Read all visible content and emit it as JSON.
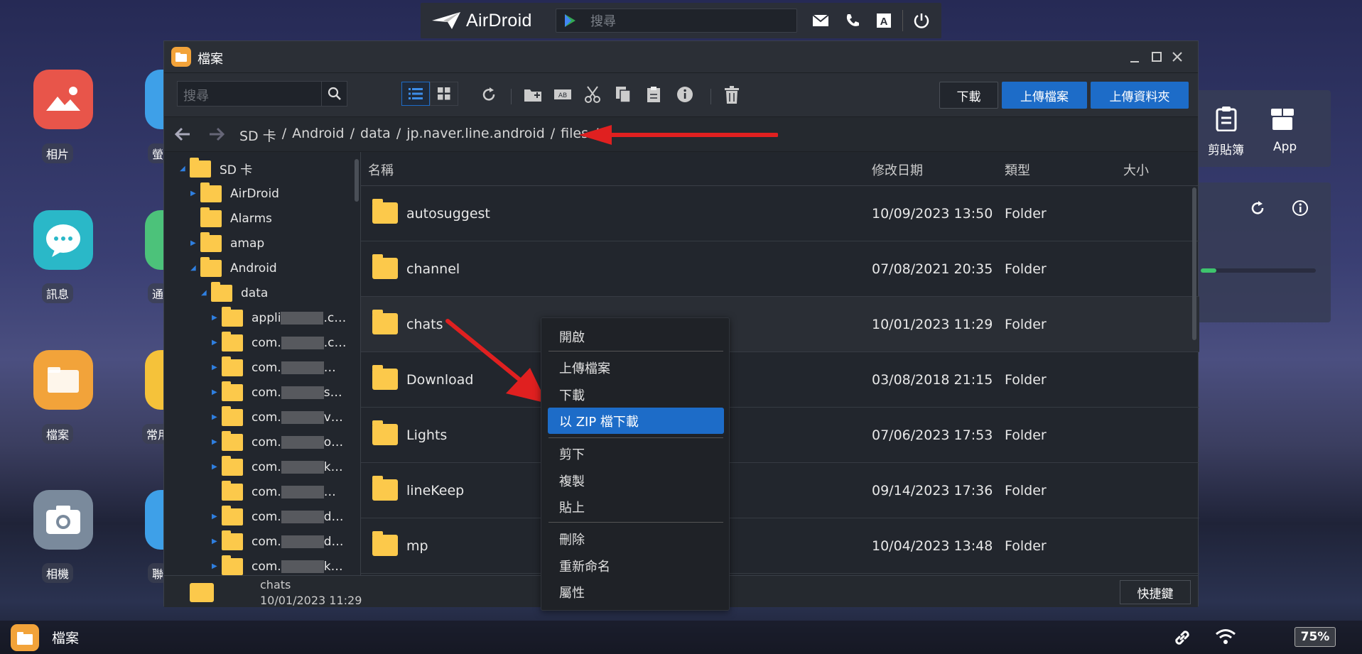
{
  "topbar": {
    "brand": "AirDroid",
    "search_placeholder": "搜尋",
    "icons": [
      "mail-icon",
      "phone-icon",
      "text-icon",
      "power-icon"
    ]
  },
  "desktop": {
    "apps_left": [
      {
        "label": "相片",
        "icon": "photos-icon",
        "color": "#e8554a"
      },
      {
        "label": "訊息",
        "icon": "messages-icon",
        "color": "#2ab8c8"
      },
      {
        "label": "檔案",
        "icon": "files-icon",
        "color": "#f2a33a"
      },
      {
        "label": "相機",
        "icon": "camera-icon",
        "color": "#7a8a9c"
      }
    ],
    "apps_partial": [
      "螢",
      "通",
      "常用",
      "聯"
    ],
    "widget_top": {
      "items": [
        "剪貼簿",
        "App"
      ]
    }
  },
  "window": {
    "title": "檔案",
    "search_placeholder": "搜尋",
    "buttons": {
      "download": "下載",
      "upload_file": "上傳檔案",
      "upload_folder": "上傳資料夾"
    },
    "path": [
      "SD 卡",
      "Android",
      "data",
      "jp.naver.line.android",
      "files"
    ],
    "path_sep": "/",
    "tree": {
      "root": "SD 卡",
      "items": [
        "AirDroid",
        "Alarms",
        "amap",
        "Android",
        "data"
      ],
      "children": [
        "appli",
        "com.",
        "com.",
        "com.",
        "com.",
        "com.",
        "com.",
        "com.",
        "com.",
        "com.",
        "com."
      ],
      "suffixes": [
        ".c…",
        ".c…",
        "…",
        "s…",
        "v…",
        "o…",
        "k…",
        "…",
        "d…",
        "d…",
        "k…"
      ]
    },
    "columns": {
      "name": "名稱",
      "date": "修改日期",
      "type": "類型",
      "size": "大小"
    },
    "files": [
      {
        "name": "autosuggest",
        "date": "10/09/2023 13:50",
        "type": "Folder"
      },
      {
        "name": "channel",
        "date": "07/08/2021 20:35",
        "type": "Folder"
      },
      {
        "name": "chats",
        "date": "10/01/2023 11:29",
        "type": "Folder"
      },
      {
        "name": "Download",
        "date": "03/08/2018 21:15",
        "type": "Folder"
      },
      {
        "name": "Lights",
        "date": "07/06/2023 17:53",
        "type": "Folder"
      },
      {
        "name": "lineKeep",
        "date": "09/14/2023 17:36",
        "type": "Folder"
      },
      {
        "name": "mp",
        "date": "10/04/2023 13:48",
        "type": "Folder"
      }
    ],
    "status": {
      "name": "chats",
      "date": "10/01/2023 11:29",
      "shortcut": "快捷鍵"
    }
  },
  "context_menu": {
    "open": "開啟",
    "upload": "上傳檔案",
    "download": "下載",
    "zip": "以 ZIP 檔下載",
    "cut": "剪下",
    "copy": "複製",
    "paste": "貼上",
    "delete": "刪除",
    "rename": "重新命名",
    "properties": "屬性"
  },
  "taskbar": {
    "app": "檔案",
    "battery": "75%"
  },
  "colors": {
    "accent": "#1d6cc8",
    "folder": "#fcc94b",
    "arrow": "#e02020"
  }
}
